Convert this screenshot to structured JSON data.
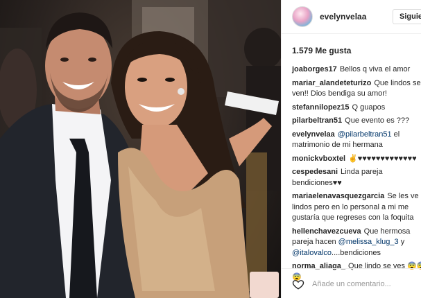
{
  "post": {
    "username": "evelynvelaa",
    "follow_label": "Siguie",
    "likes": "1.579 Me gusta",
    "add_comment_placeholder": "Añade un comentario..."
  },
  "comments": [
    {
      "user": "joaborges17",
      "text": "Bellos q viva el amor"
    },
    {
      "user": "mariar_alandeteturizo",
      "text": "Que lindos se ven!! Dios bendiga su amor!"
    },
    {
      "user": "stefannilopez15",
      "text": "Q guapos"
    },
    {
      "user": "pilarbeltran51",
      "text": "Que evento es ???"
    },
    {
      "user": "evelynvelaa",
      "mention": "@pilarbeltran51",
      "text": " el matrimonio de mi hermana"
    },
    {
      "user": "monickvboxtel",
      "text": "✌♥♥♥♥♥♥♥♥♥♥♥♥♥"
    },
    {
      "user": "cespedesani",
      "text": "Linda pareja bendiciones♥♥"
    },
    {
      "user": "mariaelenavasquezgarcia",
      "text": "Se les ve lindos pero en lo personal a mi me gustaría que regreses con la foquita"
    },
    {
      "user": "hellenchavezcueva",
      "text": "Que hermosa pareja hacen ",
      "mention": "@melissa_klug_3",
      "text2": " y ",
      "mention2": "@italovalco",
      "text3": "....bendiciones"
    },
    {
      "user": "norma_aliaga_",
      "text": "Que lindo se ves 😨😨😨"
    }
  ],
  "colors": {
    "border": "#efefef",
    "text": "#262626",
    "mention": "#003569",
    "placeholder": "#999999"
  },
  "icons": [
    "heart-icon"
  ]
}
